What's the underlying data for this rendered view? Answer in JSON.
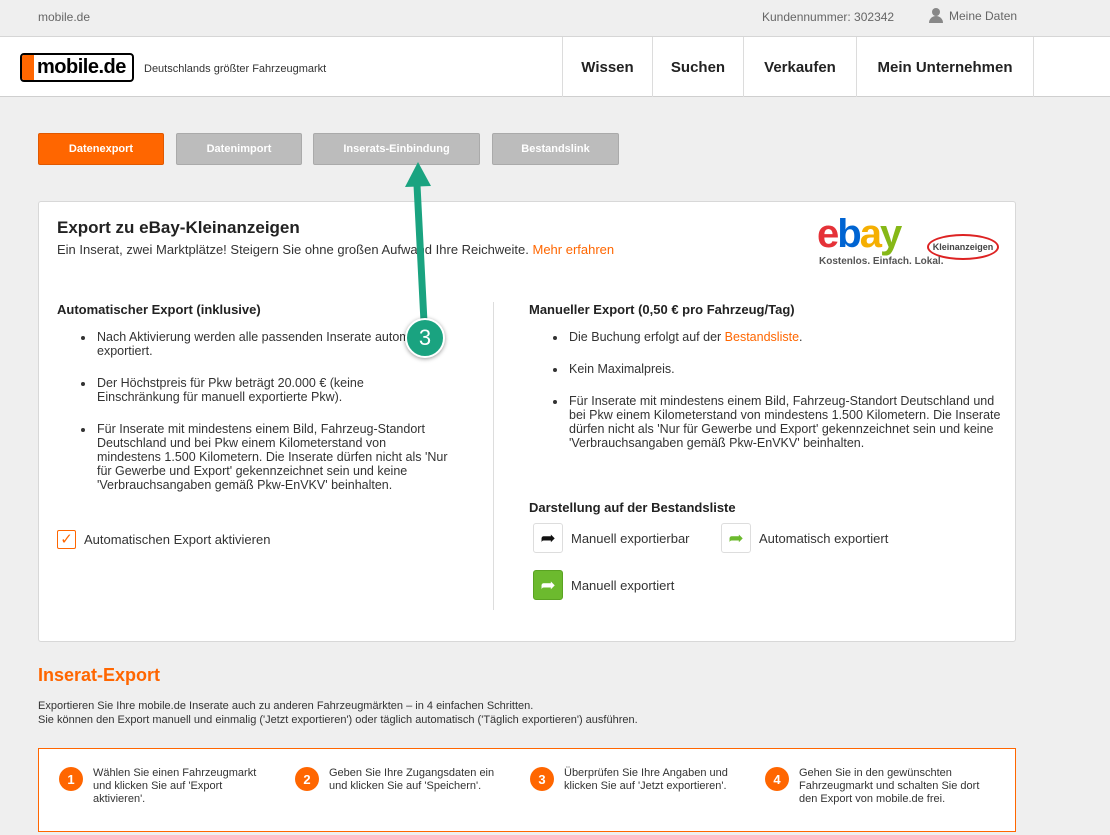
{
  "topbar": {
    "site": "mobile.de",
    "customer_number": "Kundennummer: 302342",
    "my_data": "Meine Daten"
  },
  "header": {
    "logo_text": "mobile.de",
    "tagline": "Deutschlands größter Fahrzeugmarkt",
    "nav": [
      "Wissen",
      "Suchen",
      "Verkaufen",
      "Mein Unternehmen"
    ]
  },
  "tabs": [
    {
      "label": "Datenexport",
      "active": true
    },
    {
      "label": "Datenimport",
      "active": false
    },
    {
      "label": "Inserats-Einbindung",
      "active": false
    },
    {
      "label": "Bestandslink",
      "active": false
    }
  ],
  "card": {
    "title": "Export zu eBay-Kleinanzeigen",
    "intro": "Ein Inserat, zwei Marktplätze! Steigern Sie ohne großen Aufwand Ihre Reichweite.",
    "intro_link": "Mehr erfahren",
    "ebay": {
      "word": "ebay",
      "badge": "Kleinanzeigen",
      "slogan": "Kostenlos. Einfach. Lokal."
    },
    "auto": {
      "title": "Automatischer Export (inklusive)",
      "bullets": [
        "Nach Aktivierung werden alle passenden Inserate automatisch exportiert.",
        "Der Höchstpreis für Pkw beträgt 20.000 € (keine Einschränkung für manuell exportierte Pkw).",
        "Für Inserate mit mindestens einem Bild, Fahrzeug-Standort Deutschland und bei Pkw einem Kilometerstand von mindestens 1.500 Kilometern. Die Inserate dürfen nicht als 'Nur für Gewerbe und Export' gekennzeichnet sein und keine 'Verbrauchsangaben gemäß Pkw-EnVKV' beinhalten."
      ],
      "checkbox_label": "Automatischen Export aktivieren",
      "checkbox_checked": true
    },
    "manual": {
      "title": "Manueller Export (0,50 € pro Fahrzeug/Tag)",
      "bullet1_pre": "Die Buchung erfolgt auf der",
      "bullet1_link": "Bestandsliste",
      "bullet1_post": ".",
      "bullet2": "Kein Maximalpreis.",
      "bullet3": "Für Inserate mit mindestens einem Bild, Fahrzeug-Standort Deutschland und bei Pkw einem Kilometerstand von mindestens 1.500 Kilometern. Die Inserate dürfen nicht als 'Nur für Gewerbe und Export' gekennzeichnet sein und keine 'Verbrauchsangaben gemäß Pkw-EnVKV' beinhalten.",
      "legend_title": "Darstellung auf der Bestandsliste",
      "legend": [
        "Manuell exportierbar",
        "Automatisch exportiert",
        "Manuell exportiert"
      ]
    }
  },
  "callout": {
    "number": "3",
    "color": "#1aa380"
  },
  "export_section": {
    "title": "Inserat-Export",
    "line1": "Exportieren Sie Ihre mobile.de Inserate auch zu anderen Fahrzeugmärkten – in 4 einfachen Schritten.",
    "line2": "Sie können den Export manuell und einmalig ('Jetzt exportieren') oder täglich automatisch ('Täglich exportieren') ausführen.",
    "steps": [
      {
        "num": "1",
        "text": "Wählen Sie einen Fahrzeugmarkt und klicken Sie auf 'Export aktivieren'."
      },
      {
        "num": "2",
        "text": "Geben Sie Ihre Zugangsdaten ein und klicken Sie auf 'Speichern'."
      },
      {
        "num": "3",
        "text": "Überprüfen Sie Ihre Angaben und klicken Sie auf 'Jetzt exportieren'."
      },
      {
        "num": "4",
        "text": "Gehen Sie in den gewünschten Fahrzeugmarkt und schalten Sie dort den Export von mobile.de frei."
      }
    ]
  },
  "colors": {
    "accent": "#ff6600",
    "tab_inactive": "#bcbcbc",
    "legend_green": "#6cba2e"
  }
}
